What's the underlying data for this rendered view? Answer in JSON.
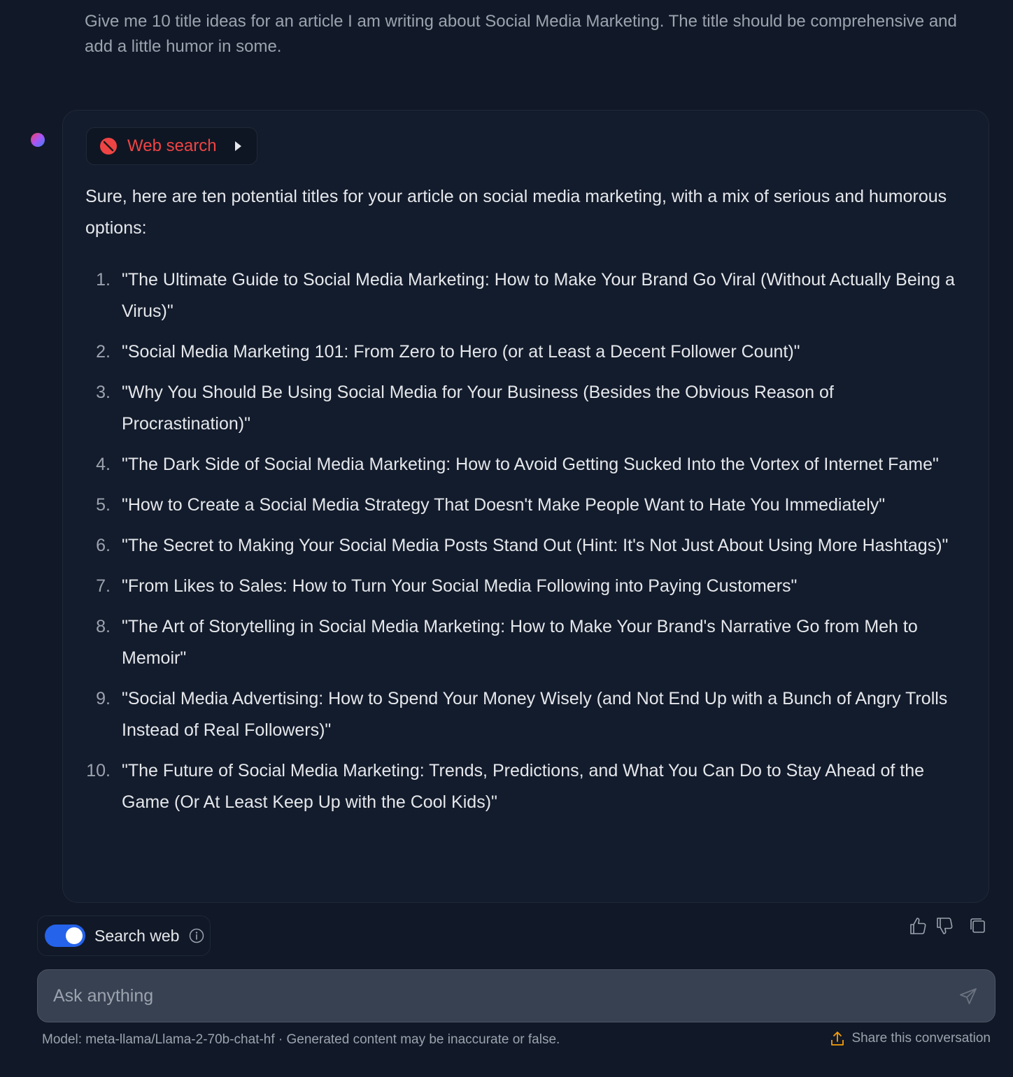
{
  "user_prompt": "Give me 10 title ideas for an article I am writing about Social Media Marketing. The title should be comprehensive and add a little humor in some.",
  "web_search_chip": {
    "label": "Web search",
    "status_color": "#ef4444"
  },
  "answer": {
    "intro": "Sure, here are ten potential titles for your article on social media marketing, with a mix of serious and humorous options:",
    "items": [
      {
        "num": "1.",
        "text": "\"The Ultimate Guide to Social Media Marketing: How to Make Your Brand Go Viral (Without Actually Being a Virus)\""
      },
      {
        "num": "2.",
        "text": "\"Social Media Marketing 101: From Zero to Hero (or at Least a Decent Follower Count)\""
      },
      {
        "num": "3.",
        "text": "\"Why You Should Be Using Social Media for Your Business (Besides the Obvious Reason of Procrastination)\""
      },
      {
        "num": "4.",
        "text": "\"The Dark Side of Social Media Marketing: How to Avoid Getting Sucked Into the Vortex of Internet Fame\""
      },
      {
        "num": "5.",
        "text": "\"How to Create a Social Media Strategy That Doesn't Make People Want to Hate You Immediately\""
      },
      {
        "num": "6.",
        "text": "\"The Secret to Making Your Social Media Posts Stand Out (Hint: It's Not Just About Using More Hashtags)\""
      },
      {
        "num": "7.",
        "text": "\"From Likes to Sales: How to Turn Your Social Media Following into Paying Customers\""
      },
      {
        "num": "8.",
        "text": "\"The Art of Storytelling in Social Media Marketing: How to Make Your Brand's Narrative Go from Meh to Memoir\""
      },
      {
        "num": "9.",
        "text": "\"Social Media Advertising: How to Spend Your Money Wisely (and Not End Up with a Bunch of Angry Trolls Instead of Real Followers)\""
      },
      {
        "num": "10.",
        "text": "\"The Future of Social Media Marketing: Trends, Predictions, and What You Can Do to Stay Ahead of the Game (Or At Least Keep Up with the Cool Kids)\""
      }
    ]
  },
  "controls": {
    "search_web_label": "Search web",
    "search_web_enabled": true,
    "toggle_color": "#2563eb"
  },
  "input": {
    "placeholder": "Ask anything"
  },
  "footer": {
    "model_note": "Model: meta-llama/Llama-2-70b-chat-hf · Generated content may be inaccurate or false.",
    "share_label": "Share this conversation",
    "share_icon_color": "#f59e0b"
  },
  "icons": [
    "error-icon",
    "caret-right-icon",
    "info-icon",
    "thumbs-up-icon",
    "thumbs-down-icon",
    "copy-icon",
    "send-icon",
    "share-upload-icon"
  ]
}
